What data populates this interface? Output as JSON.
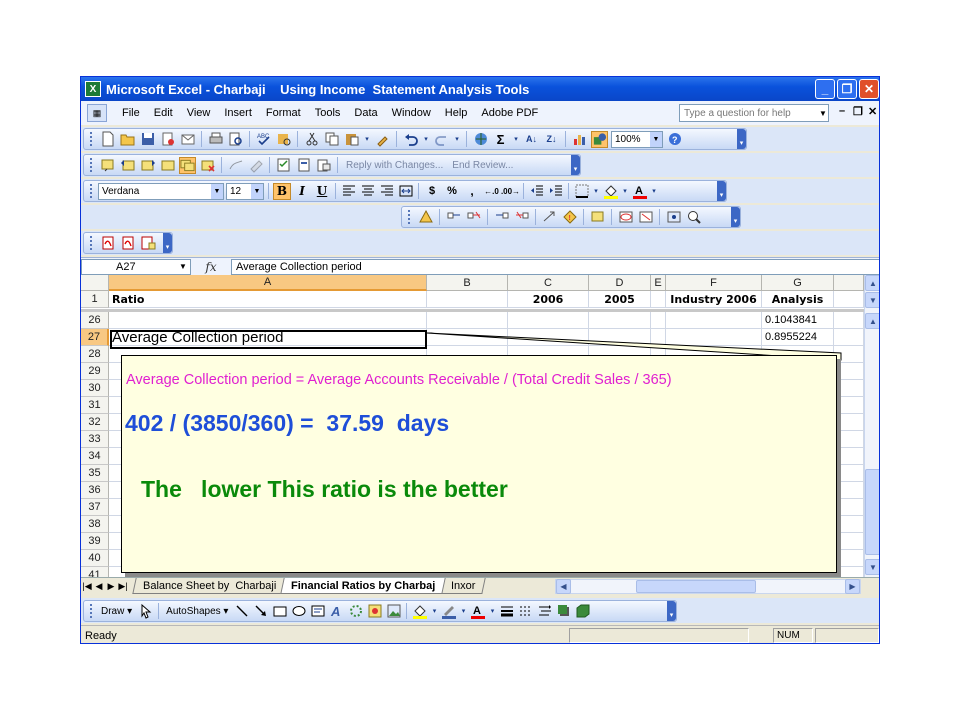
{
  "window": {
    "title": "Microsoft Excel - Charbaji    Using Income  Statement Analysis Tools",
    "app_icon": "X"
  },
  "menu": {
    "items": [
      "File",
      "Edit",
      "View",
      "Insert",
      "Format",
      "Tools",
      "Data",
      "Window",
      "Help",
      "Adobe PDF"
    ],
    "help_placeholder": "Type a question for help"
  },
  "toolbar": {
    "zoom": "100%",
    "font_name": "Verdana",
    "font_size": "12",
    "reply_with_changes": "Reply with Changes...",
    "end_review": "End Review...",
    "bold": "B",
    "italic": "I",
    "underline": "U",
    "currency": "$",
    "percent": "%",
    "comma": ","
  },
  "formula_bar": {
    "name_box": "A27",
    "fx": "fx",
    "content": "Average Collection period"
  },
  "grid": {
    "columns": [
      "A",
      "B",
      "C",
      "D",
      "E",
      "F",
      "G"
    ],
    "header_row": {
      "row": "1",
      "A": "Ratio",
      "C": "2006",
      "D": "2005",
      "F": "Industry 2006",
      "G": "Analysis"
    },
    "row_numbers": [
      "26",
      "27",
      "28",
      "29",
      "30",
      "31",
      "32",
      "33",
      "34",
      "35",
      "36",
      "37",
      "38",
      "39",
      "40",
      "41"
    ],
    "row26_g": "0.1043841",
    "row27_a": "Average Collection period",
    "row27_g": "0.8955224"
  },
  "callout": {
    "line1": "Average Collection period = Average Accounts Receivable / (Total Credit Sales / 365)",
    "line2": "402 / (3850/360) =  37.59  days",
    "line3": "The   lower This ratio is the better"
  },
  "sheet_tabs": [
    "Balance Sheet by  Charbaji",
    "Financial Ratios by Charbaj",
    "Inxor"
  ],
  "drawing": {
    "draw": "Draw",
    "autoshapes": "AutoShapes"
  },
  "status": {
    "ready": "Ready",
    "num": "NUM"
  },
  "colors": {
    "title_blue": "#0a52dc",
    "callout_magenta": "#e020d0",
    "callout_blue": "#1e4ed8",
    "callout_green": "#0a8a0a",
    "callout_bg": "#ffffe1"
  }
}
